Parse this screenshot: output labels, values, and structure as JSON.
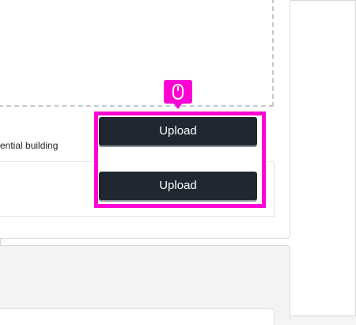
{
  "row": {
    "description": "ential building"
  },
  "actions": {
    "upload_primary_label": "Upload",
    "upload_secondary_label": "Upload"
  },
  "annotation": {
    "icon": "mouse-icon",
    "highlight_color": "#ff00d4"
  },
  "colors": {
    "button_bg": "#1e2732",
    "button_text": "#ffffff"
  }
}
